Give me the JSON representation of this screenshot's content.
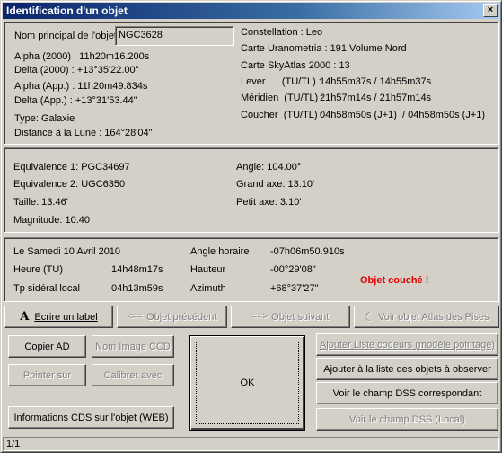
{
  "window": {
    "title": "Identification d'un objet",
    "close_glyph": "×"
  },
  "object": {
    "name_label": "Nom principal de l'objet",
    "name_value": "NGC3628",
    "alpha2000": "Alpha (2000) : 11h20m16.200s",
    "delta2000": "Delta (2000) : +13°35'22.00\"",
    "alpha_app": "Alpha (App.) : 11h20m49.834s",
    "delta_app": "Delta (App.) : +13°31'53.44\"",
    "type": "Type: Galaxie",
    "moon_distance": "Distance à la Lune : 164°28'04\"",
    "constellation": "Constellation :  Leo",
    "uranometria": "Carte Uranometria : 191  Volume Nord",
    "skyatlas": "Carte SkyAtlas 2000 : 13",
    "lever_label": "Lever      (TU/TL) :",
    "lever_value": "14h55m37s / 14h55m37s",
    "meridien_label": "Méridien  (TU/TL) :",
    "meridien_value": "21h57m14s / 21h57m14s",
    "coucher_label": "Coucher  (TU/TL) :",
    "coucher_value": "04h58m50s (J+1)  / 04h58m50s (J+1)"
  },
  "physical": {
    "equiv1": "Equivalence 1: PGC34697",
    "equiv2": "Equivalence 2: UGC6350",
    "taille": "Taille: 13.46'",
    "magnitude": "Magnitude: 10.40",
    "angle": "Angle: 104.00°",
    "grand_axe": "Grand axe: 13.10'",
    "petit_axe": "Petit axe: 3.10'"
  },
  "observation": {
    "date": "Le Samedi 10 Avril 2010",
    "heure_label": "Heure (TU)",
    "heure_value": "14h48m17s",
    "tsl_label": "Tp sidéral local",
    "tsl_value": "04h13m59s",
    "angle_horaire_label": "Angle horaire",
    "angle_horaire_value": "-07h06m50.910s",
    "hauteur_label": "Hauteur",
    "hauteur_value": "-00°29'08\"",
    "azimuth_label": "Azimuth",
    "azimuth_value": "+68°37'27\"",
    "status": "Objet couché !"
  },
  "toolbar": {
    "label_button": "Ecrire un label",
    "label_icon_glyph": "A",
    "prev_button": "Objet précédent",
    "prev_icon_glyph": "<==",
    "next_button": "Objet suivant",
    "next_icon_glyph": "==>",
    "atlas_button": "Voir objet Atlas des Pises",
    "atlas_icon_glyph": "☾"
  },
  "actions": {
    "copier_ad": "Copier AD",
    "nom_image_ccd": "Nom Image CCD",
    "pointer_sur": "Pointer sur",
    "calibrer_avec": "Calibrer avec",
    "infos_cds": "Informations CDS sur l'objet (WEB)",
    "ok": "OK",
    "ajouter_codeurs": "Ajouter Liste codeurs (modèle pointage)",
    "ajouter_liste": "Ajouter à la liste des objets à observer",
    "voir_dss": "Voir le champ DSS correspondant",
    "voir_dss_local": "Voir le champ DSS (Local)"
  },
  "statusbar": {
    "text": "1/1"
  }
}
